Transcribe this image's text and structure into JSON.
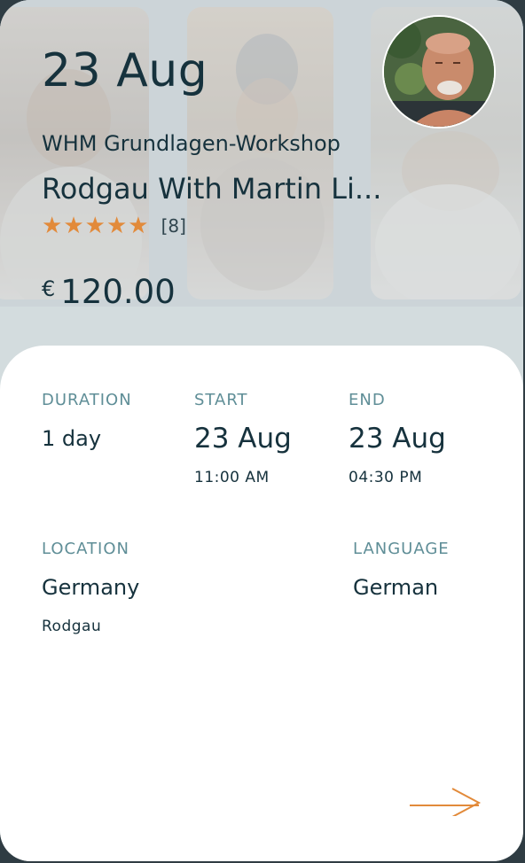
{
  "hero": {
    "date": "23 Aug",
    "event_type": "WHM Grundlagen-Workshop",
    "title": "Rodgau With Martin Li...",
    "rating": {
      "stars": 5,
      "count_label": "[8]"
    },
    "price": {
      "currency": "€",
      "amount": "120.00"
    }
  },
  "details": {
    "duration": {
      "label": "DURATION",
      "value": "1 day"
    },
    "start": {
      "label": "START",
      "date": "23 Aug",
      "time": "11:00 AM"
    },
    "end": {
      "label": "END",
      "date": "23 Aug",
      "time": "04:30 PM"
    },
    "location": {
      "label": "LOCATION",
      "country": "Germany",
      "city": "Rodgau"
    },
    "language": {
      "label": "LANGUAGE",
      "value": "German"
    }
  },
  "icons": {
    "star": "star-icon",
    "next": "arrow-right-icon"
  },
  "colors": {
    "accent": "#e28a3a",
    "text_primary": "#16323d",
    "label": "#5f8e97",
    "card_bg": "#ffffff",
    "hero_bg": "#c6cfd2"
  }
}
